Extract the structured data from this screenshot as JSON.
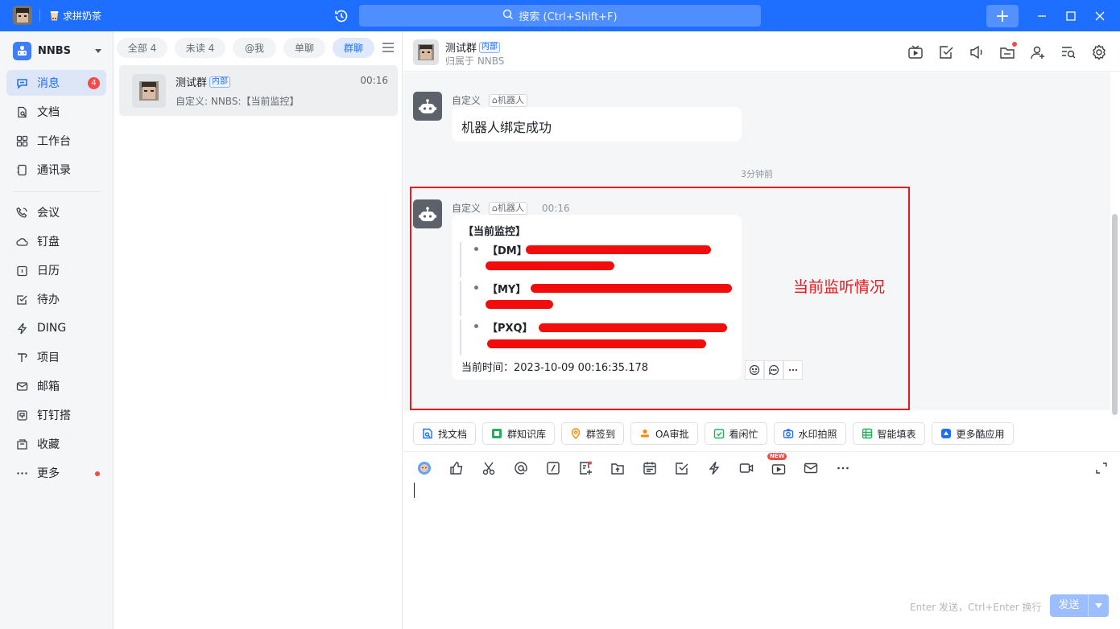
{
  "titlebar": {
    "tab_label": "求拼奶茶",
    "search_placeholder": "搜索 (Ctrl+Shift+F)"
  },
  "org": {
    "name": "NNBS"
  },
  "nav": {
    "items": [
      {
        "label": "消息",
        "icon": "chat-icon",
        "badge": "4"
      },
      {
        "label": "文档",
        "icon": "doc-icon"
      },
      {
        "label": "工作台",
        "icon": "grid-icon"
      },
      {
        "label": "通讯录",
        "icon": "contacts-icon"
      },
      {
        "label": "会议",
        "icon": "phone-icon"
      },
      {
        "label": "钉盘",
        "icon": "cloud-icon"
      },
      {
        "label": "日历",
        "icon": "calendar-icon"
      },
      {
        "label": "待办",
        "icon": "todo-icon"
      },
      {
        "label": "DING",
        "icon": "lightning-icon"
      },
      {
        "label": "项目",
        "icon": "project-icon"
      },
      {
        "label": "邮箱",
        "icon": "mail-icon"
      },
      {
        "label": "钉钉搭",
        "icon": "builder-icon"
      },
      {
        "label": "收藏",
        "icon": "favorites-icon"
      },
      {
        "label": "更多",
        "icon": "more-icon"
      }
    ]
  },
  "filters": [
    {
      "label": "全部",
      "count": "4"
    },
    {
      "label": "未读",
      "count": "4"
    },
    {
      "label": "@我"
    },
    {
      "label": "单聊"
    },
    {
      "label": "群聊"
    }
  ],
  "conversation": {
    "name": "测试群",
    "tag": "内部",
    "time": "00:16",
    "preview": "自定义: NNBS:【当前监控】"
  },
  "chat": {
    "title": "测试群",
    "tag": "内部",
    "subtitle": "归属于 NNBS",
    "messages": [
      {
        "sender": "自定义",
        "role": "机器人",
        "text": "机器人绑定成功"
      },
      {
        "sender": "自定义",
        "role": "机器人",
        "time": "00:16",
        "title": "【当前监控】",
        "items": [
          "【DM】",
          "【MY】",
          "【PXQ】"
        ],
        "footer": "当前时间：2023-10-09 00:16:35.178"
      }
    ],
    "divider_time": "3分钟前",
    "annotation": "当前监听情况"
  },
  "quick_actions": [
    {
      "label": "找文档",
      "color": "#1e6fff"
    },
    {
      "label": "群知识库",
      "color": "#1fb05a"
    },
    {
      "label": "群签到",
      "color": "#ff8800"
    },
    {
      "label": "OA审批",
      "color": "#ff8800"
    },
    {
      "label": "看闲忙",
      "color": "#1fb05a"
    },
    {
      "label": "水印拍照",
      "color": "#1e6fff"
    },
    {
      "label": "智能填表",
      "color": "#1fb05a"
    },
    {
      "label": "更多酷应用",
      "color": "#1e6fff"
    }
  ],
  "composer": {
    "hint": "Enter 发送，Ctrl+Enter 换行",
    "send_label": "发送",
    "new_badge": "NEW"
  },
  "colors": {
    "accent": "#1e6fff",
    "annotation": "#e8191c",
    "badge": "#f54a45"
  }
}
